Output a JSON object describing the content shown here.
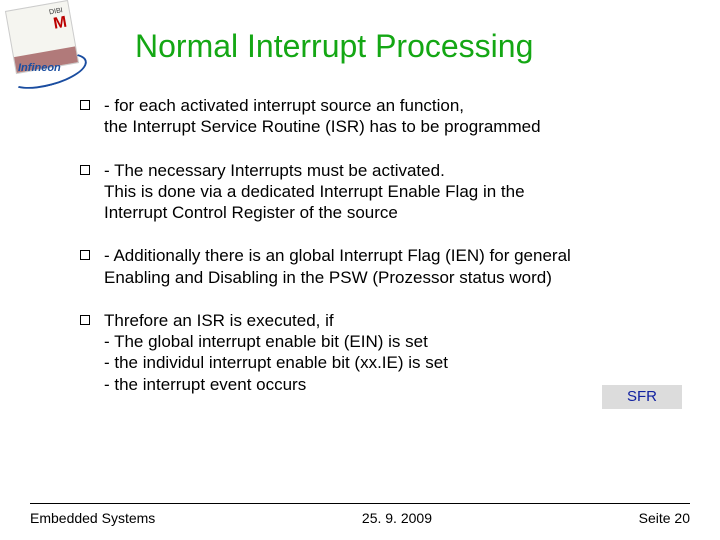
{
  "title": "Normal Interrupt Processing",
  "bullets": [
    {
      "text": "- for each activated interrupt source  an function,\n   the Interrupt Service Routine (ISR) has to  be  programmed"
    },
    {
      "text": "- The necessary Interrupts must be activated.\n   This is done via a dedicated Interrupt Enable Flag in the\n    Interrupt Control Register of the source"
    },
    {
      "text": "- Additionally there is an global Interrupt Flag (IEN) for general\n   Enabling and Disabling in the PSW (Prozessor status word)"
    },
    {
      "text": " Threfore an ISR is executed, if\n  - The global interrupt enable bit (EIN) is set\n  -  the individul interrupt enable bit (xx.IE) is set\n  -  the interrupt event occurs"
    }
  ],
  "sfr_label": "SFR",
  "footer": {
    "left": "Embedded Systems",
    "center": "25. 9. 2009",
    "right": "Seite 20"
  },
  "logo": {
    "tag": "DIBI",
    "m": "M",
    "brand": "Infineon"
  }
}
